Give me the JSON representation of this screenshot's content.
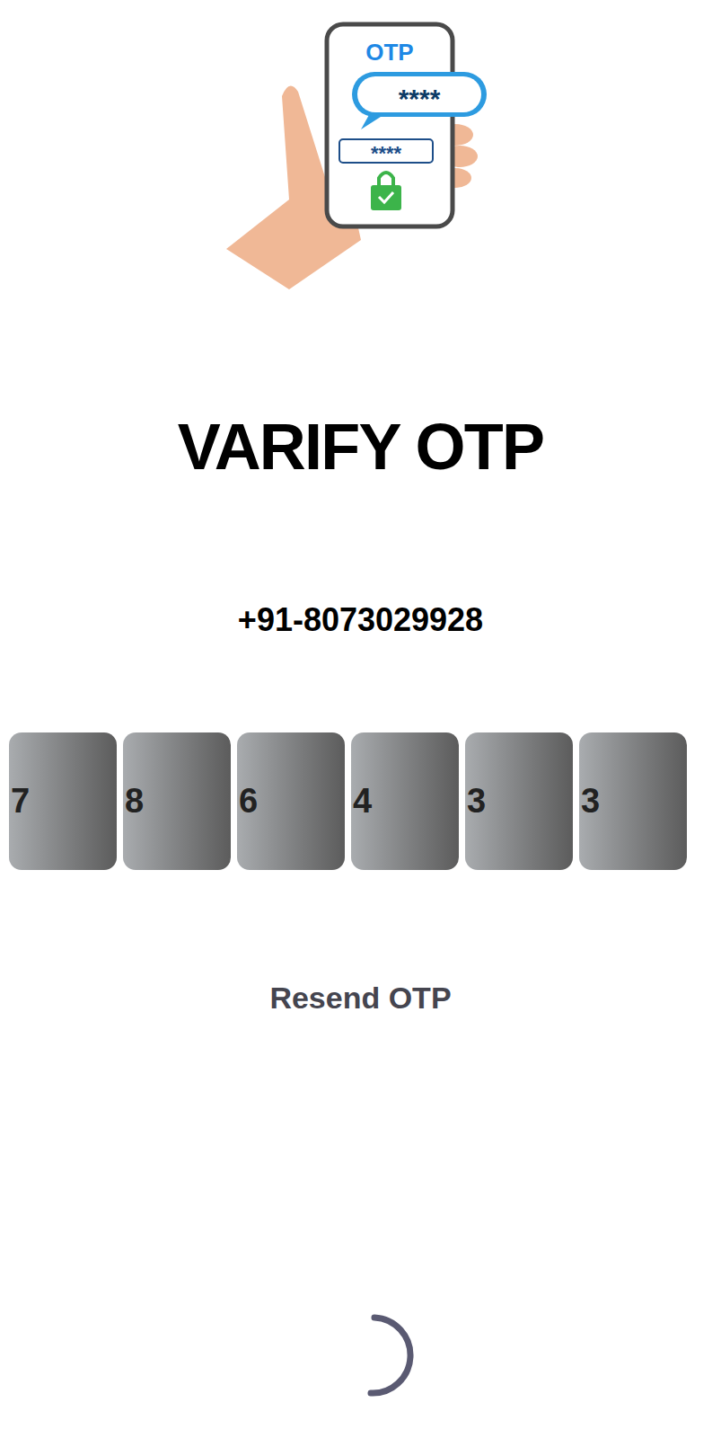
{
  "illustration": {
    "label": "OTP",
    "bubble_code": "****",
    "field_code": "****"
  },
  "title": "VARIFY OTP",
  "phone": "+91-8073029928",
  "otp_digits": [
    "7",
    "8",
    "6",
    "4",
    "3",
    "3"
  ],
  "resend": "Resend OTP",
  "loading": true
}
